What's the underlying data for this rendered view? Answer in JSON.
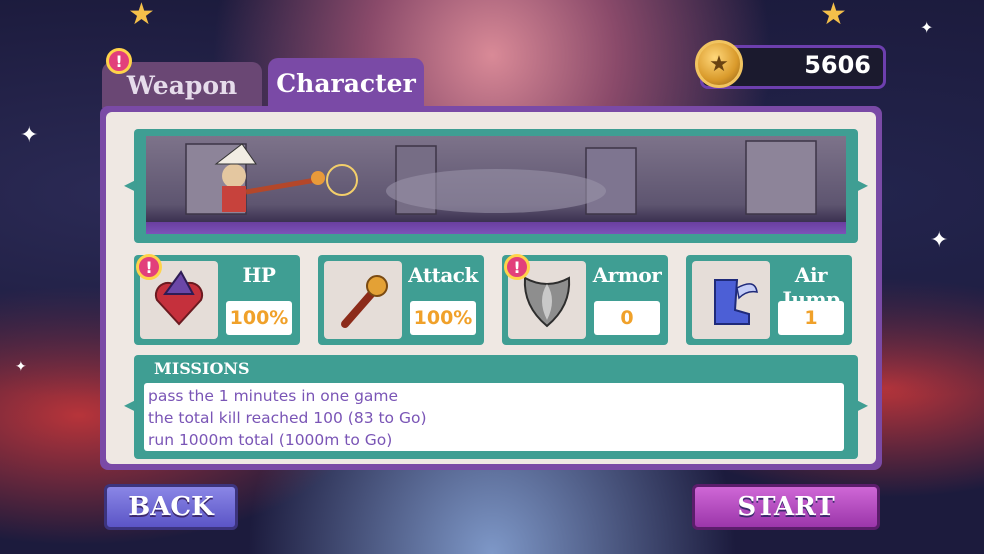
{
  "currency": {
    "value": "5606",
    "icon": "coin-icon"
  },
  "tabs": [
    {
      "label": "Weapon",
      "active": false,
      "badge": "!"
    },
    {
      "label": "Character",
      "active": true
    }
  ],
  "stats": [
    {
      "label": "HP",
      "value": "100%",
      "icon": "witch-heart-icon",
      "badge": "!"
    },
    {
      "label": "Attack",
      "value": "100%",
      "icon": "staff-icon"
    },
    {
      "label": "Armor",
      "value": "0",
      "icon": "shield-icon",
      "badge": "!"
    },
    {
      "label": "Air Jump",
      "value": "1",
      "icon": "winged-boot-icon"
    }
  ],
  "missions": {
    "title": "MISSIONS",
    "items": [
      "pass the 1 minutes in one game",
      "the total kill reached 100 (83 to Go)",
      "run 1000m total (1000m to Go)"
    ]
  },
  "buttons": {
    "back": "BACK",
    "start": "START"
  },
  "colors": {
    "panel": "#7a4aa6",
    "teal": "#3f9e93",
    "value_text": "#f0a12a",
    "mission_text": "#7a55b6"
  }
}
